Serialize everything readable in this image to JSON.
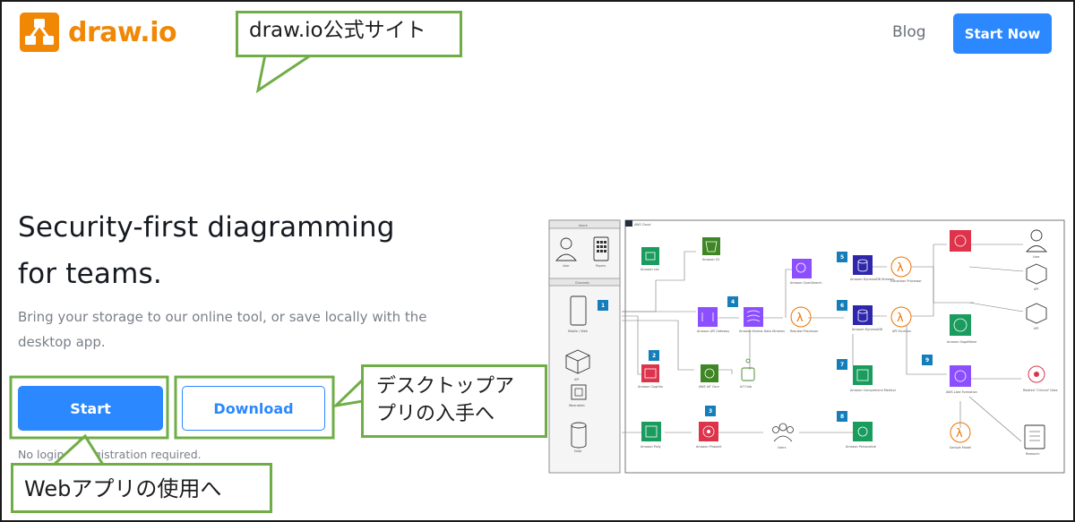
{
  "header": {
    "brand": "draw.io",
    "nav_blog": "Blog",
    "start_now": "Start Now"
  },
  "hero": {
    "title_line1": "Security-first diagramming",
    "title_line2": "for teams.",
    "subtitle": "Bring your storage to our online tool, or save locally with the desktop app.",
    "start_button": "Start",
    "download_button": "Download",
    "note": "No login or registration required."
  },
  "callouts": {
    "official_site": "draw.io公式サイト",
    "desktop_app": "デスクトップアプリの入手へ",
    "web_app": "Webアプリの使用へ"
  },
  "diagram": {
    "left_panel": {
      "title": "Azure",
      "channels": "Channels",
      "items": [
        "User",
        "Payers",
        "Mobile / Web",
        "API",
        "Wearables",
        "Data"
      ]
    },
    "cloud_label": "AWS Cloud",
    "step_numbers": [
      "1",
      "2",
      "3",
      "4",
      "5",
      "6",
      "7",
      "8",
      "9"
    ],
    "service_labels": [
      "Amazon Lex",
      "Amazon S3",
      "Amazon Cognito",
      "AWS IoT Core",
      "IoT Hub",
      "Amazon API Gateway",
      "Amazon Kinesis Data Streams",
      "Amazon Pinpoint",
      "Amazon Polly",
      "Request Processor",
      "Amazon OpenSearch",
      "Amazon DynamoDB Streams",
      "Amazon DynamoDB",
      "Extraction Processor",
      "API Function",
      "Amazon Comprehend Medical",
      "Amazon Personalize",
      "Users",
      "AWS Lake Formation",
      "Amazon SageMaker",
      "Sample Model",
      "Research"
    ],
    "right_labels": [
      "User",
      "API",
      "API",
      "Related \"Clinical\" Data"
    ]
  },
  "colors": {
    "brand_orange": "#f08705",
    "primary_blue": "#2b88ff",
    "callout_green": "#70ad47"
  }
}
